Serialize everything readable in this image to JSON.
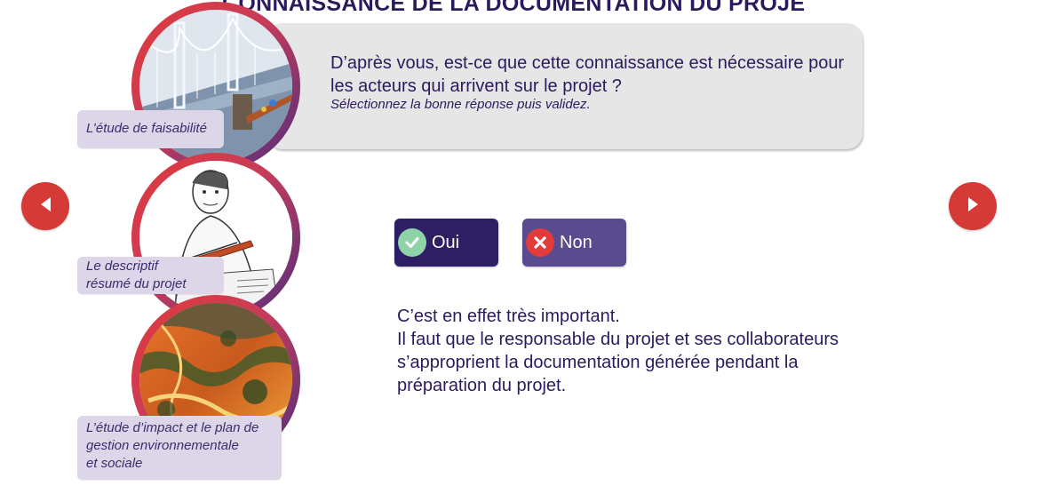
{
  "title": "CONNAISSANCE DE LA DOCUMENTATION DU PROJET",
  "question": {
    "text": "D’après vous, est-ce que cette connaissance est nécessaire pour les acteurs qui arrivent sur le projet ?",
    "hint": "Sélectionnez la bonne réponse puis validez."
  },
  "documents": [
    {
      "caption": "L’étude de faisabilité",
      "image": "suspension-bridge-illustration"
    },
    {
      "caption_lines": [
        "Le descriptif",
        "résumé du projet"
      ],
      "image": "man-writing-sketch"
    },
    {
      "caption_lines": [
        "L’étude d’impact et le plan de",
        "gestion environnementale",
        "et sociale"
      ],
      "image": "red-earth-landscape-photo"
    }
  ],
  "answers": {
    "yes": {
      "label": "Oui",
      "icon": "check-circle-icon",
      "color": "#2e1e63"
    },
    "no": {
      "label": "Non",
      "icon": "x-circle-icon",
      "color": "#5a4a8e"
    }
  },
  "feedback": {
    "lines": [
      "C’est en effet très important.",
      "Il faut que le responsable du projet et ses collaborateurs",
      "s’approprient la documentation générée pendant la",
      "préparation du projet."
    ]
  },
  "navigation": {
    "prev_icon": "arrow-left-icon",
    "next_icon": "arrow-right-icon",
    "color": "#d63a36"
  }
}
